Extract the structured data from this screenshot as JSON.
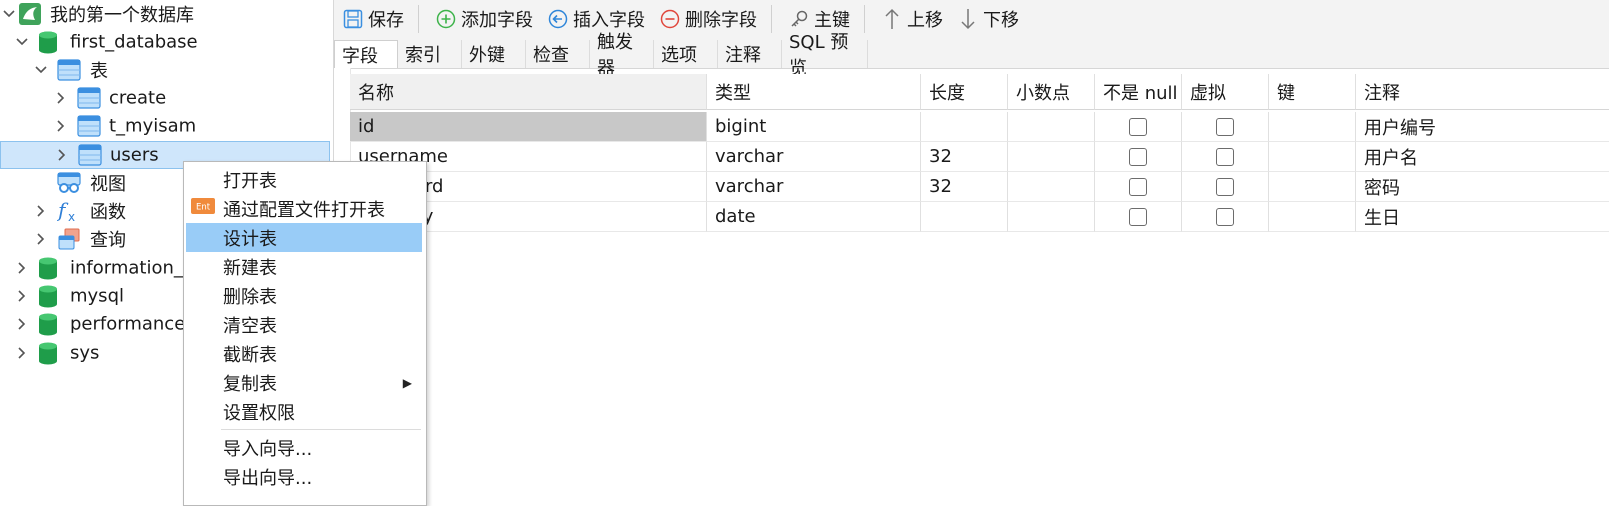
{
  "tree": {
    "connection": "我的第一个数据库",
    "first_database": "first_database",
    "tables_folder": "表",
    "tables": [
      "create",
      "t_myisam",
      "users"
    ],
    "views_folder": "视图",
    "functions_folder": "函数",
    "queries_folder": "查询",
    "other_databases": [
      "information_s",
      "mysql",
      "performance_",
      "sys"
    ]
  },
  "toolbar": {
    "save": "保存",
    "add_field": "添加字段",
    "insert_field": "插入字段",
    "delete_field": "删除字段",
    "primary_key": "主键",
    "move_up": "上移",
    "move_down": "下移"
  },
  "tabs": [
    "字段",
    "索引",
    "外键",
    "检查",
    "触发器",
    "选项",
    "注释",
    "SQL 预览"
  ],
  "grid": {
    "headers": [
      "名称",
      "类型",
      "长度",
      "小数点",
      "不是 null",
      "虚拟",
      "键",
      "注释"
    ],
    "rows": [
      {
        "name": "id",
        "type": "bigint",
        "length": "",
        "comment": "用户编号"
      },
      {
        "name": "username",
        "type": "varchar",
        "length": "32",
        "comment": "用户名"
      },
      {
        "name": "password",
        "type": "varchar",
        "length": "32",
        "comment": "密码"
      },
      {
        "name": "birthday",
        "type": "date",
        "length": "",
        "comment": "生日"
      }
    ]
  },
  "context_menu": {
    "items": [
      "打开表",
      "通过配置文件打开表",
      "设计表",
      "新建表",
      "删除表",
      "清空表",
      "截断表",
      "复制表",
      "设置权限",
      "导入向导...",
      "导出向导..."
    ],
    "ent_badge": "Ent",
    "highlighted": "设计表"
  },
  "colors": {
    "selection": "#cfe6fb",
    "menu_highlight": "#99ccf7",
    "db_green": "#1f9d4a",
    "table_blue": "#3b8fe0"
  }
}
